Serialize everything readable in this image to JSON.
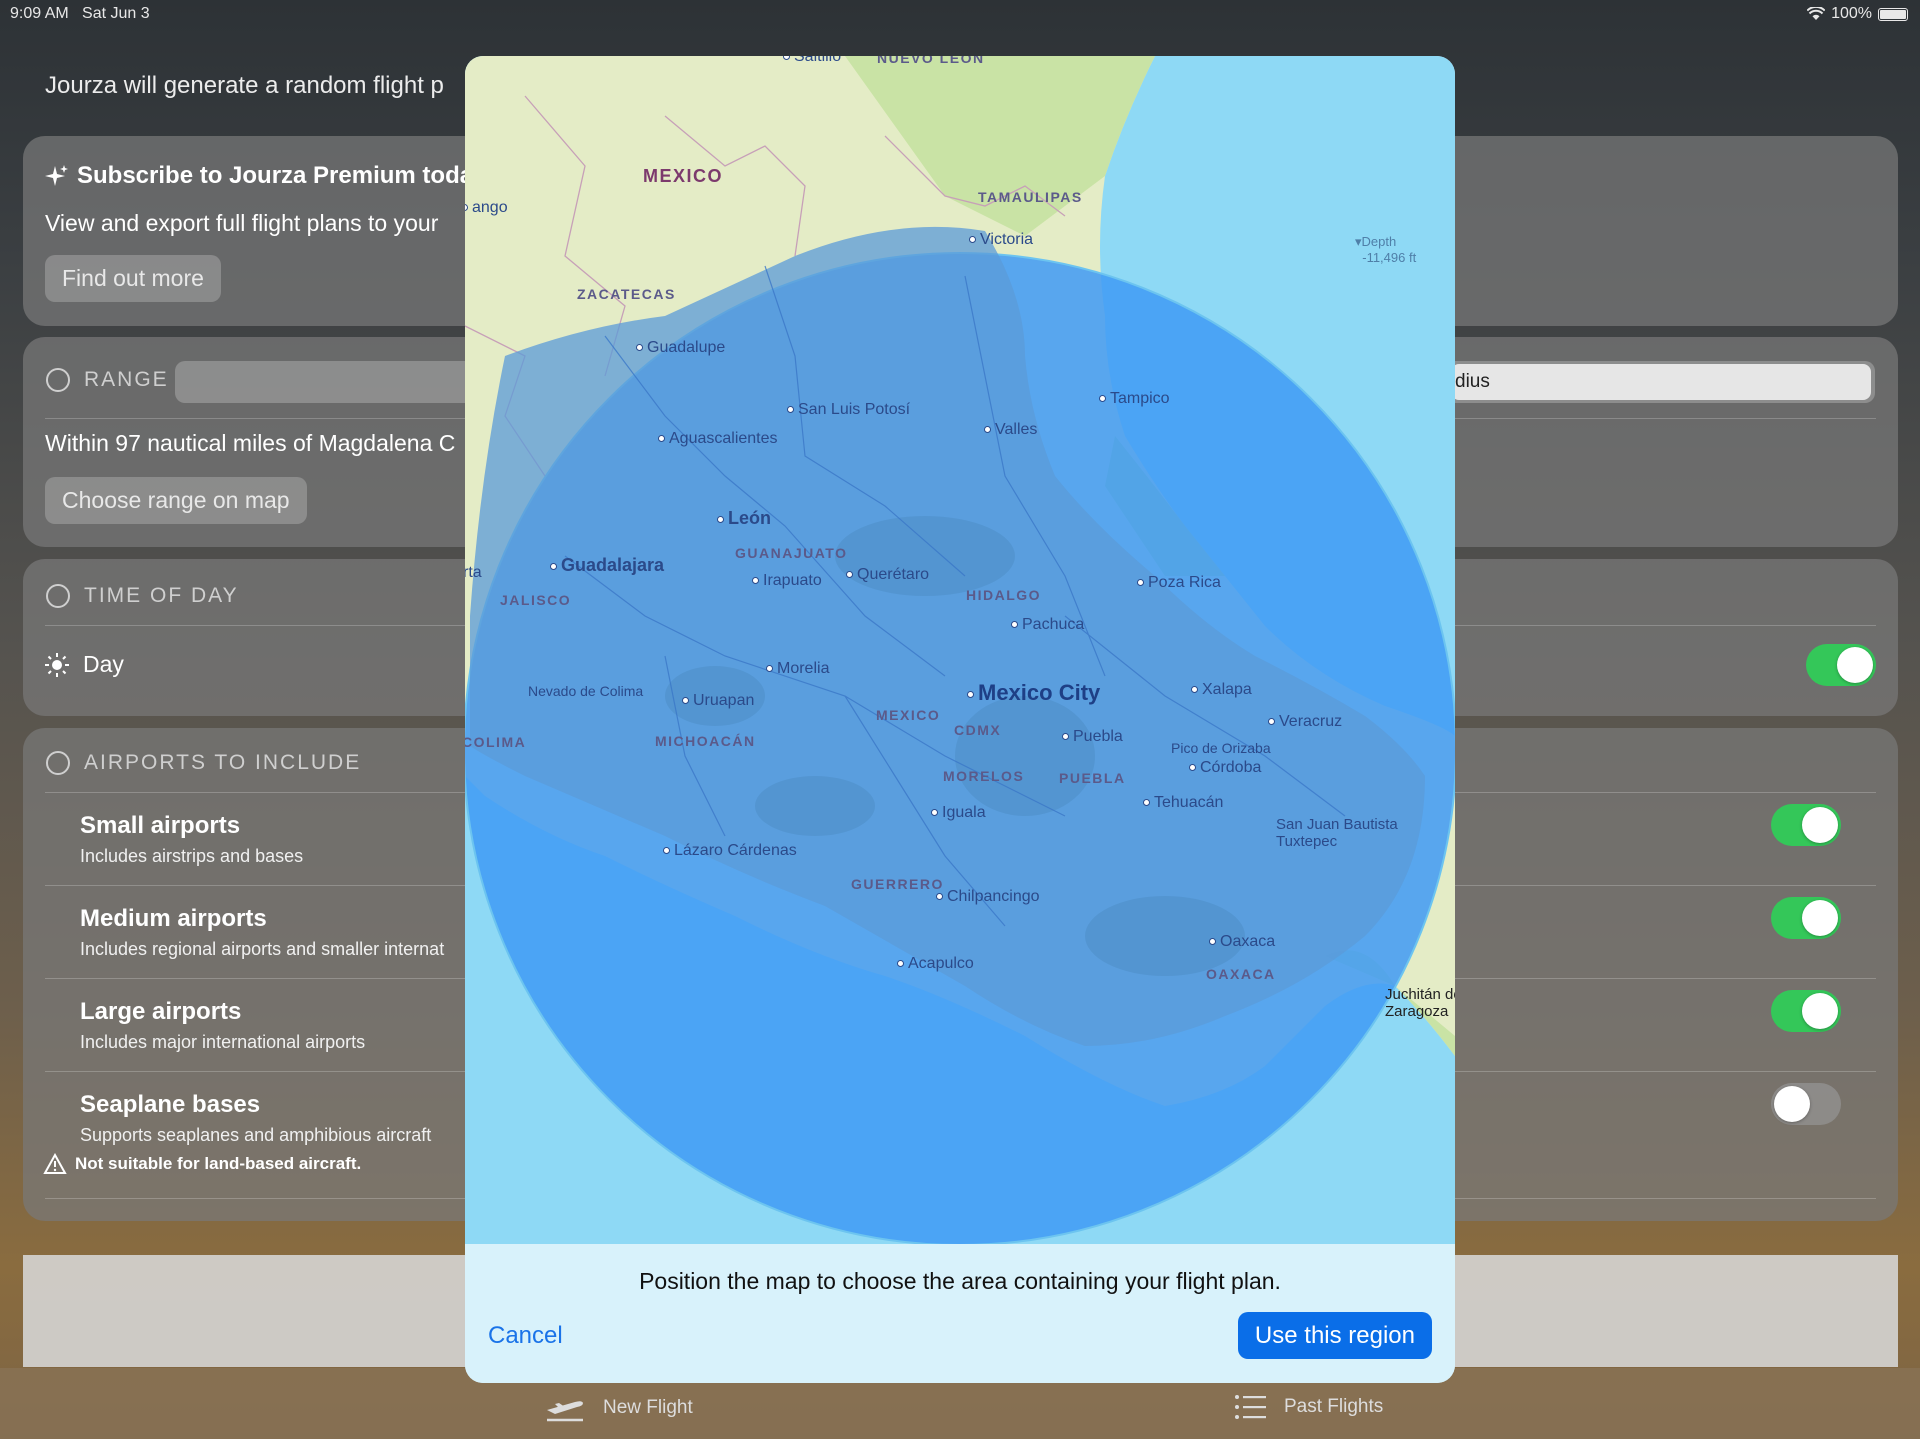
{
  "status_bar": {
    "time": "9:09 AM",
    "date": "Sat Jun 3",
    "battery": "100%"
  },
  "intro_text": "Jourza will generate a random flight p",
  "premium": {
    "title": "Subscribe to Jourza Premium toda",
    "body": "View and export full flight plans to your",
    "button": "Find out more",
    "icon": "sparkle-icon"
  },
  "range": {
    "header": "RANGE",
    "segment_right": "dius",
    "description": "Within 97 nautical miles of Magdalena C",
    "button": "Choose range on map"
  },
  "time_of_day": {
    "header": "TIME OF DAY",
    "label": "Day",
    "enabled": true
  },
  "airports": {
    "header": "AIRPORTS TO INCLUDE",
    "items": [
      {
        "title": "Small airports",
        "subtitle": "Includes airstrips and bases",
        "enabled": true
      },
      {
        "title": "Medium airports",
        "subtitle": "Includes regional airports and smaller internat",
        "enabled": true
      },
      {
        "title": "Large airports",
        "subtitle": "Includes major international airports",
        "enabled": true
      },
      {
        "title": "Seaplane bases",
        "subtitle": "Supports seaplanes and amphibious aircraft",
        "enabled": false
      }
    ],
    "warning": "Not suitable for land-based aircraft."
  },
  "tabs": [
    {
      "label": "New Flight",
      "icon": "airplane-icon"
    },
    {
      "label": "Past Flights",
      "icon": "list-icon"
    }
  ],
  "map": {
    "country": "MEXICO",
    "states": [
      "NUEVO LEON",
      "TAMAULIPAS",
      "ZACATECAS",
      "GUANAJUATO",
      "JALISCO",
      "HIDALGO",
      "MEXICO",
      "CDMX",
      "MICHOACÁN",
      "MORELOS",
      "PUEBLA",
      "GUERRERO",
      "OAXACA",
      "COLIMA"
    ],
    "cities": [
      "Saltillo",
      "ango",
      "Victoria",
      "Guadalupe",
      "Tampico",
      "San Luis Potosí",
      "Valles",
      "Aguascalientes",
      "León",
      "rta",
      "Guadalajara",
      "Irapuato",
      "Querétaro",
      "Poza Rica",
      "Pachuca",
      "Morelia",
      "Nevado de Colima",
      "Uruapan",
      "Mexico City",
      "Xalapa",
      "Veracruz",
      "Puebla",
      "Pico de Orizaba",
      "Córdoba",
      "Tehuacán",
      "Iguala",
      "San Juan Bautista Tuxtepec",
      "Lázaro Cárdenas",
      "Chilpancingo",
      "Acapulco",
      "Oaxaca",
      "Juchitán de Zaragoza"
    ],
    "depth_label": "Depth",
    "depth_value": "-11,496 ft"
  },
  "modal": {
    "instruction": "Position the map to choose the area containing your flight plan.",
    "cancel": "Cancel",
    "confirm": "Use this region"
  }
}
